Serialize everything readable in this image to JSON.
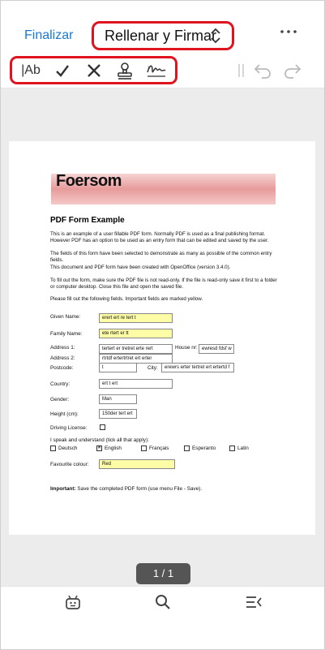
{
  "header": {
    "finish_label": "Finalizar",
    "mode_title": "Rellenar y Firmar"
  },
  "colors": {
    "accent": "#1a78d6",
    "highlight": "#e0141e",
    "required_field": "#fdfca7"
  },
  "toolbar": {
    "text_tool_label": "|Ab",
    "icons": [
      "text-tool-icon",
      "check-mark-icon",
      "cross-mark-icon",
      "stamp-icon",
      "signature-icon",
      "divider-icon",
      "undo-icon",
      "redo-icon"
    ]
  },
  "document": {
    "banner_logo": "Foersom",
    "title": "PDF Form Example",
    "paragraphs": [
      "This is an example of a user fillable PDF form. Normally PDF is used as a final publishing format. However PDF has an option to be used as an entry form that can be edited and saved by the user.",
      "The fields of this form have been selected to demonstrate as many as possible of the common entry fields.",
      "This document and PDF form have been created with OpenOffice (version 3.4.0).",
      "To fill out the form, make sure the PDF file is not read-only. If the file is read-only save it first to a folder or computer desktop. Close this file and open the saved file.",
      "Please fill out the following fields. Important fields are marked yellow."
    ],
    "labels": {
      "given_name": "Given Name:",
      "family_name": "Family Name:",
      "address1": "Address 1:",
      "house_nr": "House nr:",
      "address2": "Address 2:",
      "postcode": "Postcode:",
      "city": "City:",
      "country": "Country:",
      "gender": "Gender:",
      "height": "Height (cm):",
      "driving_license": "Driving License:",
      "languages": "I speak and understand (tick all that apply):",
      "favourite_colour": "Favourite colour:"
    },
    "values": {
      "given_name": "erert ert re tert t",
      "family_name": "ete rtert er tt",
      "address1": "tertert er tretret  erte rert",
      "house_nr": "ewresd fdsf w",
      "address2": "rtrtdf ertertrtret ert erter",
      "postcode": "t",
      "city": "erewrs erter tertret ert ertertd f",
      "country": "ert t ert",
      "gender": "Man",
      "height": "150der tert ert",
      "favourite_colour": "Red"
    },
    "languages": [
      {
        "name": "Deutsch",
        "checked": false
      },
      {
        "name": "English",
        "checked": true
      },
      {
        "name": "Français",
        "checked": false
      },
      {
        "name": "Esperanto",
        "checked": false
      },
      {
        "name": "Latin",
        "checked": false
      }
    ],
    "important_bold": "Important:",
    "important_text": " Save the completed PDF form (use menu File - Save)."
  },
  "page_indicator": "1 / 1",
  "bottom_bar": {
    "icons": [
      "assistant-icon",
      "search-icon",
      "outline-menu-icon"
    ]
  }
}
